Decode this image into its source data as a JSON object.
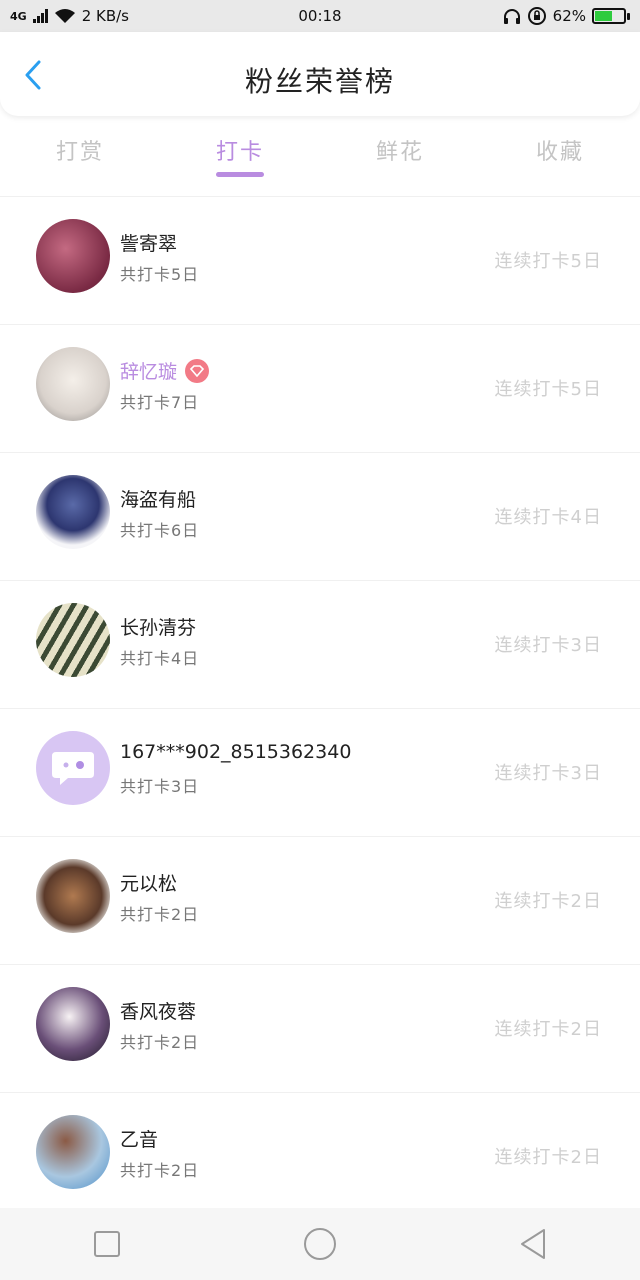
{
  "status_bar": {
    "network": "4G",
    "speed": "2 KB/s",
    "time": "00:18",
    "battery": "62%",
    "battery_color": "#2ecb3d",
    "icons": [
      "signal-icon",
      "wifi-icon",
      "headphones-icon",
      "rotation-lock-icon",
      "battery-icon"
    ]
  },
  "header": {
    "title": "粉丝荣誉榜",
    "back_icon": "chevron-left-icon",
    "accent": "#2a9ff0"
  },
  "tabs": [
    {
      "label": "打赏",
      "active": false
    },
    {
      "label": "打卡",
      "active": true
    },
    {
      "label": "鲜花",
      "active": false
    },
    {
      "label": "收藏",
      "active": false
    }
  ],
  "accent_color": "#b98ce0",
  "fans": [
    {
      "name": "訾寄翠",
      "total": "共打卡5日",
      "streak": "连续打卡5日",
      "vip": false
    },
    {
      "name": "辞忆璇",
      "total": "共打卡7日",
      "streak": "连续打卡5日",
      "vip": true
    },
    {
      "name": "海盗有船",
      "total": "共打卡6日",
      "streak": "连续打卡4日",
      "vip": false
    },
    {
      "name": "长孙清芬",
      "total": "共打卡4日",
      "streak": "连续打卡3日",
      "vip": false
    },
    {
      "name": "167***902_8515362340",
      "total": "共打卡3日",
      "streak": "连续打卡3日",
      "vip": false
    },
    {
      "name": "元以松",
      "total": "共打卡2日",
      "streak": "连续打卡2日",
      "vip": false
    },
    {
      "name": "香风夜蓉",
      "total": "共打卡2日",
      "streak": "连续打卡2日",
      "vip": false
    },
    {
      "name": "乙音",
      "total": "共打卡2日",
      "streak": "连续打卡2日",
      "vip": false
    }
  ],
  "nav": {
    "icons": [
      "recent-apps-icon",
      "home-icon",
      "back-icon"
    ]
  }
}
